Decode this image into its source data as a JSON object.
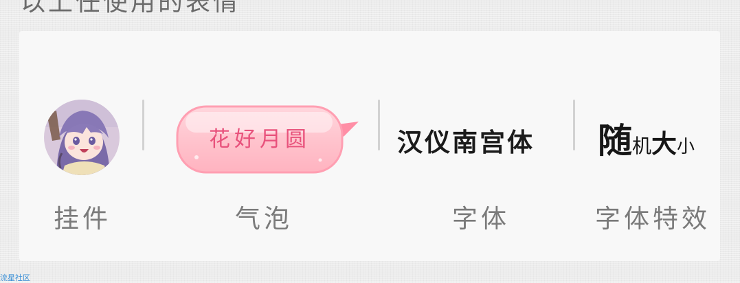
{
  "header": {
    "caption": "以上任使用的表情"
  },
  "features": [
    {
      "label": "挂件",
      "icon": "anime-avatar-pendant"
    },
    {
      "label": "气泡",
      "sample": "花好月圆",
      "icon": "pink-speech-bubble"
    },
    {
      "label": "字体",
      "sample": "汉仪南宫体"
    },
    {
      "label": "字体特效",
      "sample_chars": [
        "随",
        "机",
        "大",
        "小"
      ]
    }
  ],
  "watermark": "流星社区",
  "colors": {
    "bubble_fill": "#ffc5cf",
    "bubble_text": "#e8527c",
    "label_text": "#7a7a7a",
    "card_bg": "#f8f8f8",
    "watermark": "#3a8fd6"
  }
}
